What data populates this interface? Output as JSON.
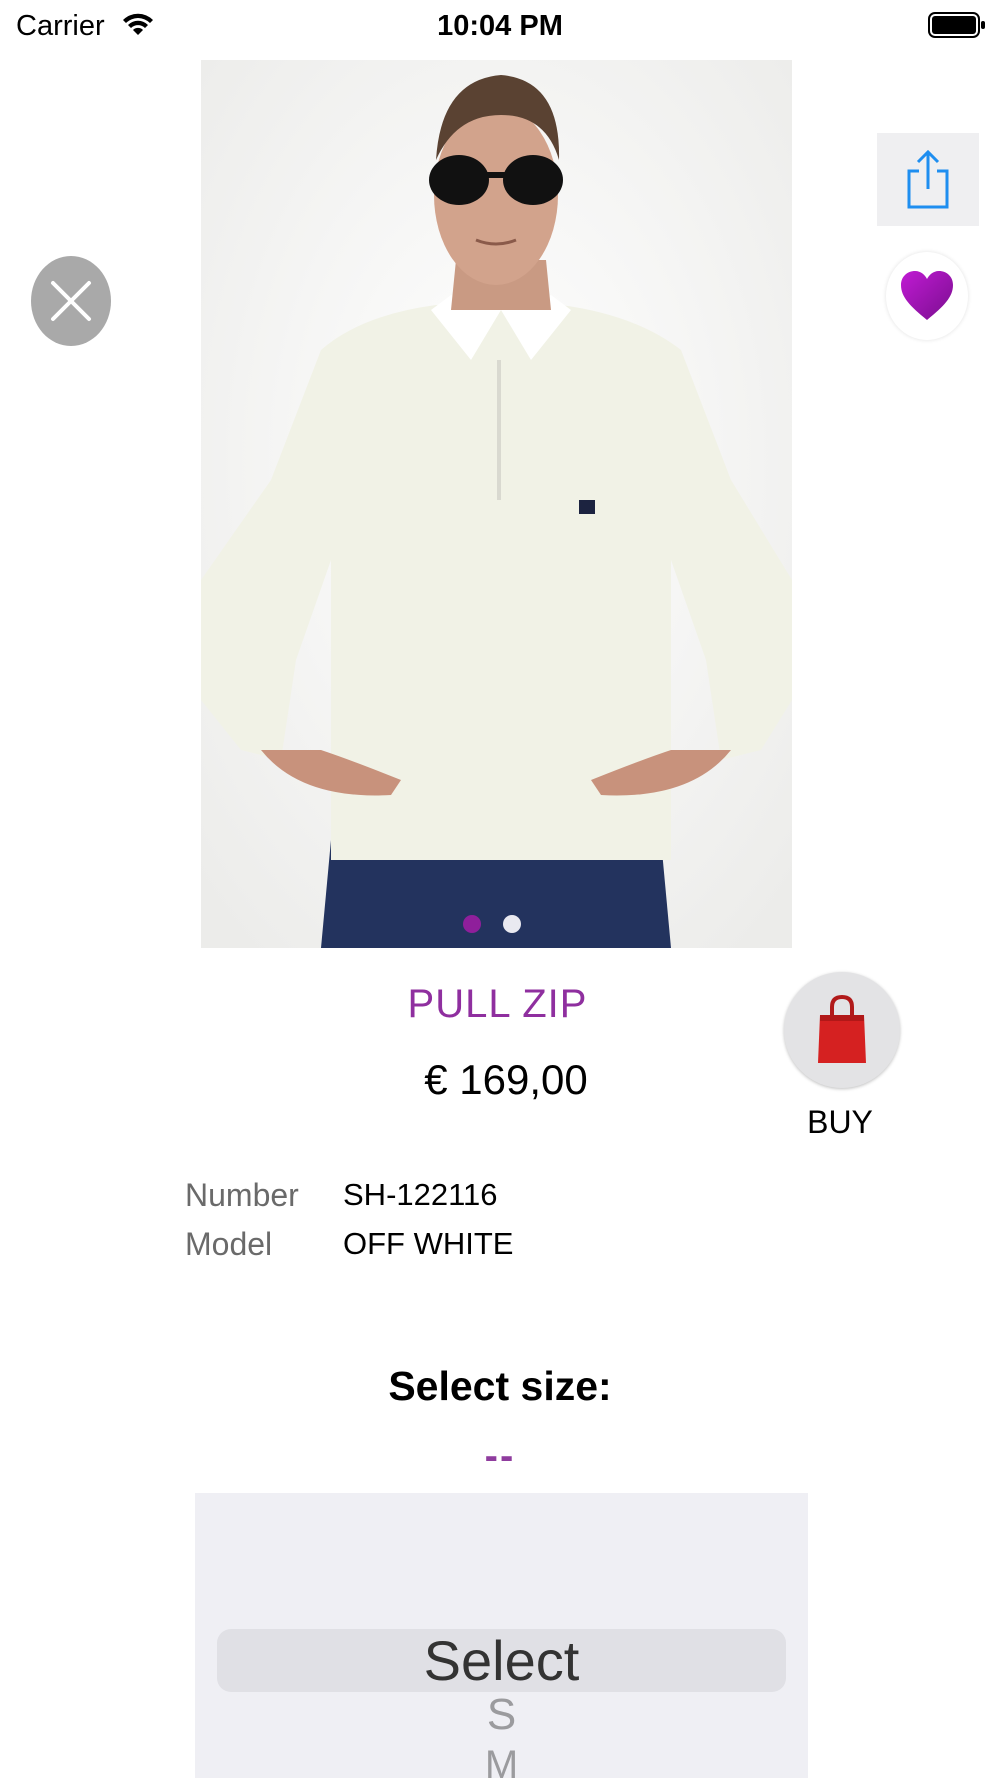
{
  "status_bar": {
    "carrier": "Carrier",
    "time": "10:04 PM"
  },
  "gallery": {
    "page_count": 2,
    "current_page": 1,
    "active_dot_color": "#8f1f9b"
  },
  "actions": {
    "close_icon": "close-icon",
    "share_icon": "share-icon",
    "favorite_icon": "heart-icon",
    "favorite_color": "#a020b8"
  },
  "product": {
    "title": "PULL ZIP",
    "price": "€ 169,00",
    "title_color": "#8f2f9f"
  },
  "buy": {
    "label": "BUY",
    "icon": "shopping-bag-icon"
  },
  "details": [
    {
      "label": "Number",
      "value": "SH-122116"
    },
    {
      "label": "Model",
      "value": "OFF WHITE"
    }
  ],
  "size": {
    "heading": "Select size:",
    "current": "--"
  },
  "picker": {
    "selected": "Select",
    "options": [
      "S",
      "M"
    ]
  }
}
